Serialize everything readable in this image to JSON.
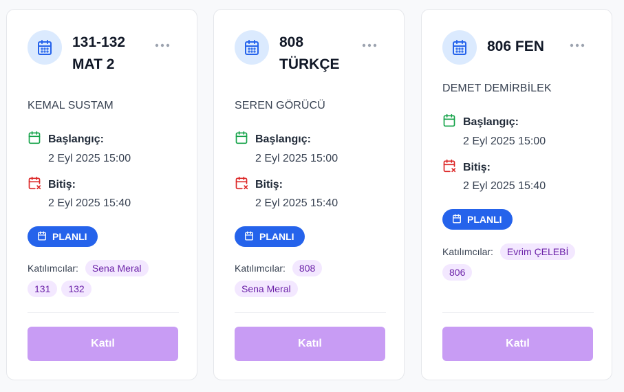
{
  "cards": [
    {
      "title_line1": "131-132",
      "title_line2": "MAT 2",
      "teacher": "KEMAL SUSTAM",
      "start_label": "Başlangıç:",
      "start_value": "2 Eyl 2025 15:00",
      "end_label": "Bitiş:",
      "end_value": "2 Eyl 2025 15:40",
      "status": "PLANLI",
      "participants_label": "Katılımcılar:",
      "participants": [
        "Sena Meral",
        "131",
        "132"
      ],
      "join_label": "Katıl"
    },
    {
      "title_line1": "808",
      "title_line2": "TÜRKÇE",
      "teacher": "SEREN GÖRÜCÜ",
      "start_label": "Başlangıç:",
      "start_value": "2 Eyl 2025 15:00",
      "end_label": "Bitiş:",
      "end_value": "2 Eyl 2025 15:40",
      "status": "PLANLI",
      "participants_label": "Katılımcılar:",
      "participants": [
        "808",
        "Sena Meral"
      ],
      "join_label": "Katıl"
    },
    {
      "title_line1": "806 FEN",
      "teacher": "DEMET DEMİRBİLEK",
      "start_label": "Başlangıç:",
      "start_value": "2 Eyl 2025 15:00",
      "end_label": "Bitiş:",
      "end_value": "2 Eyl 2025 15:40",
      "status": "PLANLI",
      "participants_label": "Katılımcılar:",
      "participants": [
        "Evrim ÇELEBİ",
        "806"
      ],
      "join_label": "Katıl"
    }
  ],
  "icons": {
    "card_icon": "calendar-icon",
    "more": "more-horizontal-icon",
    "start": "calendar-check-icon",
    "end": "calendar-x-icon",
    "status": "calendar-icon"
  },
  "colors": {
    "accent": "#2563eb",
    "icon_bg": "#dbeafe",
    "start_icon": "#16a34a",
    "end_icon": "#dc2626",
    "chip_bg": "#f3e8ff",
    "chip_text": "#6b21a8",
    "join_button": "#c89cf4"
  }
}
